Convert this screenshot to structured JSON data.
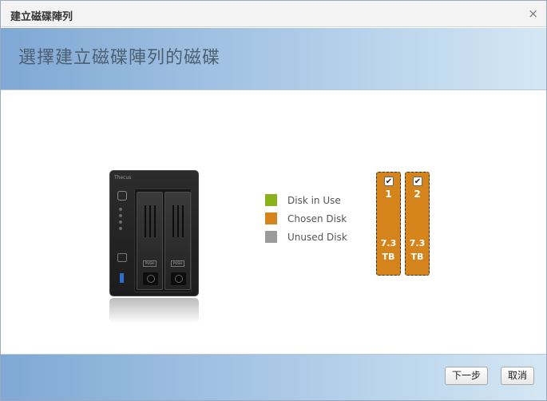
{
  "dialog": {
    "title": "建立磁碟陣列",
    "close_glyph": "×"
  },
  "header": {
    "heading": "選擇建立磁碟陣列的磁碟"
  },
  "device": {
    "logo": "Thecus",
    "push_label": "PUSH"
  },
  "legend": [
    {
      "label": "Disk in Use",
      "color": "#8ab21a"
    },
    {
      "label": "Chosen Disk",
      "color": "#d4841b"
    },
    {
      "label": "Unused Disk",
      "color": "#9b9b9b"
    }
  ],
  "disks": [
    {
      "number": "1",
      "size_value": "7.3",
      "size_unit": "TB",
      "checked": true
    },
    {
      "number": "2",
      "size_value": "7.3",
      "size_unit": "TB",
      "checked": true
    }
  ],
  "footer": {
    "next_label": "下一步",
    "cancel_label": "取消"
  }
}
